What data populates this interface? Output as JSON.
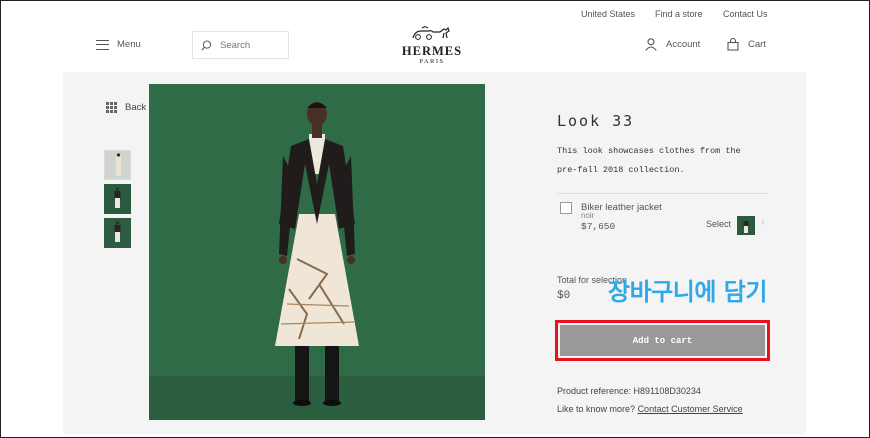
{
  "topbar": {
    "links": [
      "United States",
      "Find a store",
      "Contact Us"
    ]
  },
  "header": {
    "menu_label": "Menu",
    "search_placeholder": "Search",
    "brand": "HERMES",
    "brand_sub": "PARIS",
    "account_label": "Account",
    "cart_label": "Cart"
  },
  "gallery": {
    "back_label": "Back",
    "thumbnails": 3
  },
  "product": {
    "title": "Look 33",
    "description": "This look showcases clothes from the pre-fall 2018 collection.",
    "item": {
      "name": "Biker leather jacket",
      "color": "noir",
      "price": "$7,650",
      "select_label": "Select"
    },
    "total_label": "Total for selection",
    "total_value": "$0",
    "add_to_cart_label": "Add to cart",
    "reference": "Product reference: H891108D30234",
    "help_text": "Like to know more?",
    "help_link": "Contact Customer Service"
  },
  "annotation": {
    "text": "장바구니에 담기",
    "color": "#2ea8e6",
    "highlight_color": "#e5141c"
  },
  "icons": [
    "menu-icon",
    "search-icon",
    "account-icon",
    "cart-icon",
    "grid-icon",
    "chevron-right-icon"
  ]
}
